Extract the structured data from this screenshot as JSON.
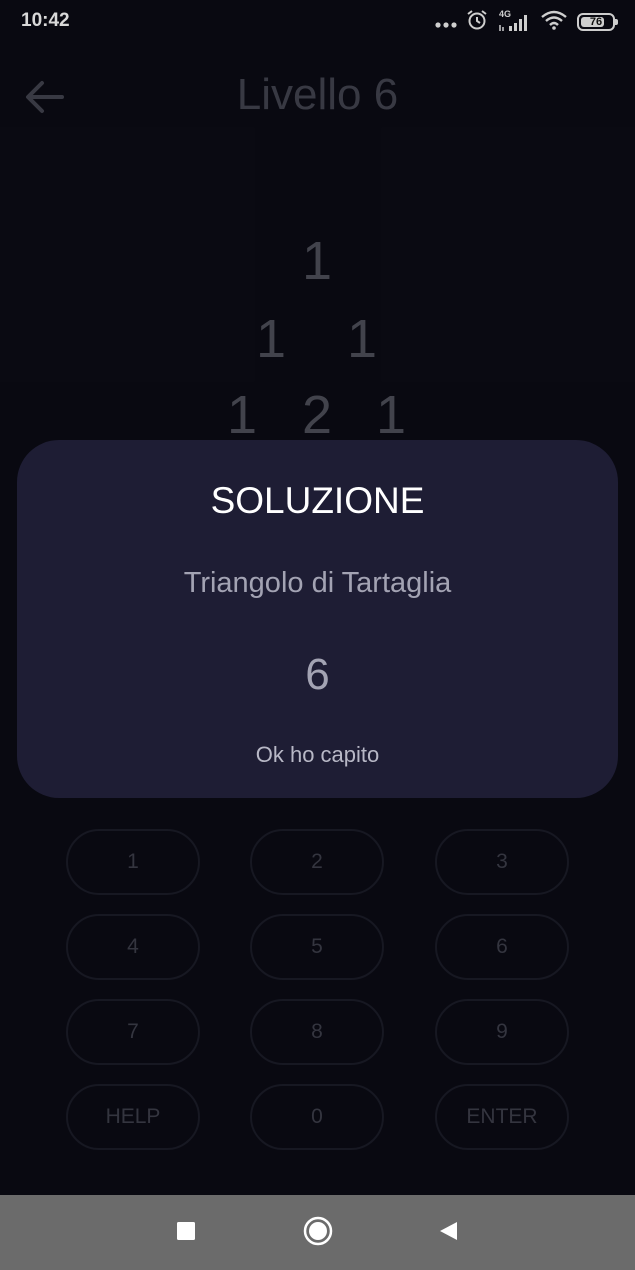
{
  "status_bar": {
    "time": "10:42",
    "network_label": "4G",
    "battery_level": 76,
    "battery_text": "76"
  },
  "header": {
    "title": "Livello 6"
  },
  "puzzle": {
    "rows": [
      [
        "1"
      ],
      [
        "1",
        "1"
      ],
      [
        "1",
        "2",
        "1"
      ]
    ]
  },
  "keypad": {
    "keys": [
      [
        "1",
        "2",
        "3"
      ],
      [
        "4",
        "5",
        "6"
      ],
      [
        "7",
        "8",
        "9"
      ],
      [
        "HELP",
        "0",
        "ENTER"
      ]
    ]
  },
  "dialog": {
    "title": "SOLUZIONE",
    "subtitle": "Triangolo di Tartaglia",
    "answer": "6",
    "ok_label": "Ok ho capito"
  },
  "colors": {
    "background": "#0b0b14",
    "dialog_background": "#1e1d34",
    "nav_bar": "#6b6b6b"
  },
  "icons": {
    "back": "arrow-left-icon",
    "nav_recents": "square-icon",
    "nav_home": "circle-icon",
    "nav_back": "triangle-icon"
  }
}
